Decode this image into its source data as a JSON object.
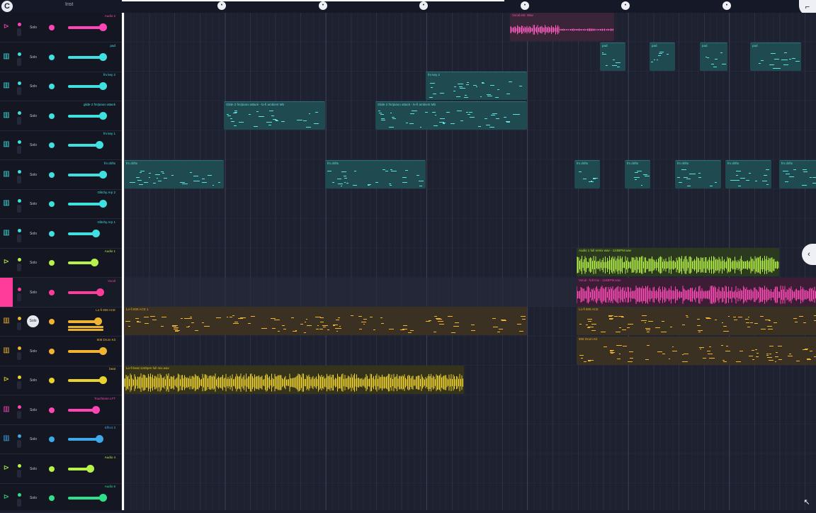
{
  "header": {
    "app_icon": "app-logo-icon",
    "inst_label": "Inst",
    "corner_icon": "collapse-icon"
  },
  "timeline": {
    "markers": [
      "•",
      "•",
      "•",
      "•",
      "•",
      "•"
    ],
    "marker_icon": "timeline-marker-icon"
  },
  "colors": {
    "background": "#1a1d2b",
    "teal": "#3ee0e0",
    "pink": "#ff45b5",
    "amber": "#f0b432",
    "green": "#b7f24a",
    "yellow": "#e8d22e",
    "blue": "#3fa8e8",
    "magenta_selected": "#ff3c9a"
  },
  "tracks": [
    {
      "name": "Audio 2",
      "icon": "audio-track-icon",
      "solo": "Solo",
      "color": "#ff45b5",
      "level": 0.72,
      "selected": false
    },
    {
      "name": "pad",
      "icon": "midi-track-icon",
      "solo": "Solo",
      "color": "#3ee0e0",
      "level": 0.72,
      "selected": false
    },
    {
      "name": "fm key 2",
      "icon": "midi-track-icon",
      "solo": "Solo",
      "color": "#3ee0e0",
      "level": 0.72,
      "selected": false
    },
    {
      "name": "glide 2 fm/piano attack",
      "icon": "midi-track-icon",
      "solo": "Solo",
      "color": "#3ee0e0",
      "level": 0.72,
      "selected": false
    },
    {
      "name": "fm key 1",
      "icon": "midi-track-icon",
      "solo": "Solo",
      "color": "#3ee0e0",
      "level": 0.64,
      "selected": false
    },
    {
      "name": "fm drifts",
      "icon": "midi-track-icon",
      "solo": "Solo",
      "color": "#3ee0e0",
      "level": 0.72,
      "selected": false
    },
    {
      "name": "Glitchy Arp 2",
      "icon": "midi-track-icon",
      "solo": "Solo",
      "color": "#3ee0e0",
      "level": 0.72,
      "selected": false
    },
    {
      "name": "Glitchy Arp 1",
      "icon": "midi-track-icon",
      "solo": "Solo",
      "color": "#3ee0e0",
      "level": 0.58,
      "selected": false
    },
    {
      "name": "Audio 1",
      "icon": "audio-track-icon",
      "solo": "Solo",
      "color": "#b7f24a",
      "level": 0.55,
      "selected": false
    },
    {
      "name": "Vocal",
      "icon": "audio-track-icon",
      "solo": "Solo",
      "color": "#ff3c9a",
      "level": 0.66,
      "selected": true
    },
    {
      "name": "Lo-fi 808 ACE",
      "icon": "midi-track-icon",
      "solo": "Solo",
      "color": "#f0b432",
      "level": 0.62,
      "selected": false,
      "solo_active": true
    },
    {
      "name": "808 Drum Kit",
      "icon": "midi-track-icon",
      "solo": "Solo",
      "color": "#f0b432",
      "level": 0.72,
      "selected": false
    },
    {
      "name": "beat",
      "icon": "audio-track-icon",
      "solo": "Solo",
      "color": "#e8d22e",
      "level": 0.72,
      "selected": false
    },
    {
      "name": "Touchtone LFT",
      "icon": "midi-track-icon",
      "solo": "Solo",
      "color": "#ff45b5",
      "level": 0.58,
      "selected": false
    },
    {
      "name": "Effect 3",
      "icon": "midi-track-icon",
      "solo": "Solo",
      "color": "#3fa8e8",
      "level": 0.64,
      "selected": false
    },
    {
      "name": "Audio 4",
      "icon": "audio-track-icon",
      "solo": "Solo",
      "color": "#b7f24a",
      "level": 0.46,
      "selected": false
    },
    {
      "name": "Audio 6",
      "icon": "audio-track-icon",
      "solo": "Solo",
      "color": "#2fe08a",
      "level": 0.72,
      "selected": false
    }
  ],
  "clips": [
    {
      "track": 0,
      "label": "Vocal ent. Wav",
      "type": "audio-pink"
    },
    {
      "track": 1,
      "label": "pad",
      "type": "midi-teal"
    },
    {
      "track": 1,
      "label": "pad",
      "type": "midi-teal"
    },
    {
      "track": 1,
      "label": "pad",
      "type": "midi-teal"
    },
    {
      "track": 1,
      "label": "pad",
      "type": "midi-teal"
    },
    {
      "track": 2,
      "label": "fm key 2",
      "type": "midi-teal"
    },
    {
      "track": 3,
      "label": "Glide 2 fm/piano attack - lo-fi ambient Mb",
      "type": "midi-teal"
    },
    {
      "track": 3,
      "label": "Glide 2 fm/piano attack - lo-fi ambient Mb",
      "type": "midi-teal"
    },
    {
      "track": 5,
      "label": "fm drifts",
      "type": "midi-teal"
    },
    {
      "track": 5,
      "label": "fm drifts",
      "type": "midi-teal"
    },
    {
      "track": 5,
      "label": "fm drifts",
      "type": "midi-teal"
    },
    {
      "track": 5,
      "label": "fm drifts",
      "type": "midi-teal"
    },
    {
      "track": 5,
      "label": "fm drifts",
      "type": "midi-teal"
    },
    {
      "track": 5,
      "label": "fm drifts",
      "type": "midi-teal"
    },
    {
      "track": 5,
      "label": "fm drifts",
      "type": "midi-teal"
    },
    {
      "track": 8,
      "label": "Audio 1 full remix wav - 124BPM.wav",
      "type": "audio-green"
    },
    {
      "track": 9,
      "label": "Vocal - full mix - 124BPM.wav",
      "type": "audio-magenta"
    },
    {
      "track": 10,
      "label": "Lo-fi 808 ACE 1",
      "type": "midi-amber"
    },
    {
      "track": 10,
      "label": "Lo-fi 808 ACE",
      "type": "midi-amber"
    },
    {
      "track": 11,
      "label": "808 Drum Kit",
      "type": "midi-amber"
    },
    {
      "track": 12,
      "label": "Lo-fi beat 124bpm full mix.wav",
      "type": "audio-yellow"
    }
  ],
  "side_icon": "expand-panel-icon",
  "corner_arrow_icon": "arrow-up-left-icon"
}
